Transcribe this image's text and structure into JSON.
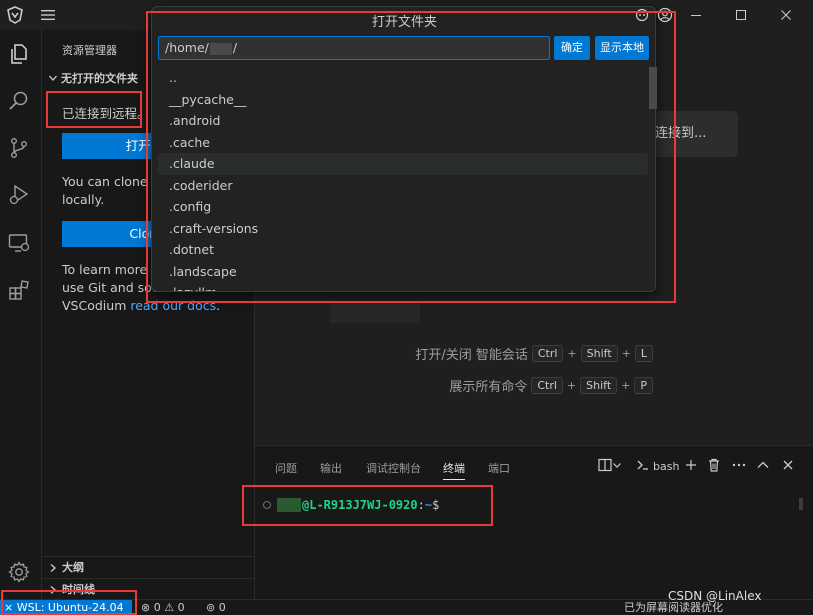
{
  "colors": {
    "accent": "#0078d4",
    "terminal_host": "#23d18b",
    "annotation": "#e53b3b"
  },
  "titlebar": {
    "icons": [
      "vscodium-logo-icon",
      "menu-icon",
      "copilot-icon",
      "account-icon",
      "minimize-icon",
      "maximize-icon",
      "close-icon"
    ]
  },
  "activitybar": {
    "icons": [
      "explorer-icon",
      "search-icon",
      "source-control-icon",
      "run-debug-icon",
      "remote-explorer-icon",
      "extensions-icon",
      "gear-icon"
    ]
  },
  "sidebar": {
    "title": "资源管理器",
    "section": "无打开的文件夹",
    "remote_status": "已连接到远程。",
    "open_folder_button": "打开文件夹",
    "clone_text_line1": "You can clone a",
    "clone_text_line2": "locally.",
    "clone_button": "Clone Re",
    "learn_line1": "To learn more a",
    "learn_line2": "use Git and sou",
    "learn_line3_prefix": "VSCodium ",
    "learn_link": "read our docs",
    "learn_suffix": ".",
    "outline": "大纲",
    "timeline": "时间线"
  },
  "editor": {
    "connect_button": "连接到...",
    "shortcuts": [
      {
        "label": "打开/关闭 智能会话",
        "keys": [
          "Ctrl",
          "Shift",
          "L"
        ]
      },
      {
        "label": "展示所有命令",
        "keys": [
          "Ctrl",
          "Shift",
          "P"
        ]
      }
    ]
  },
  "panel": {
    "tabs": [
      "问题",
      "输出",
      "调试控制台",
      "终端",
      "端口"
    ],
    "active_tab": "终端",
    "terminal_name": "bash",
    "prompt_host": "@L-R913J7WJ-0920",
    "prompt_sep": ":",
    "prompt_path": "~",
    "prompt_symbol": "$"
  },
  "quickpick": {
    "title": "打开文件夹",
    "input_prefix": "/home/",
    "input_suffix": "/",
    "ok_button": "确定",
    "show_local_button": "显示本地",
    "items": [
      "..",
      "__pycache__",
      ".android",
      ".cache",
      ".claude",
      ".coderider",
      ".config",
      ".craft-versions",
      ".dotnet",
      ".landscape",
      ".lazyllm"
    ],
    "selected_index": 4
  },
  "statusbar": {
    "remote": "WSL: Ubuntu-24.04",
    "errors": "0",
    "warnings": "0",
    "ports": "0",
    "right_text": "已为屏幕阅读器优化"
  },
  "watermark": "CSDN @LinAlex"
}
